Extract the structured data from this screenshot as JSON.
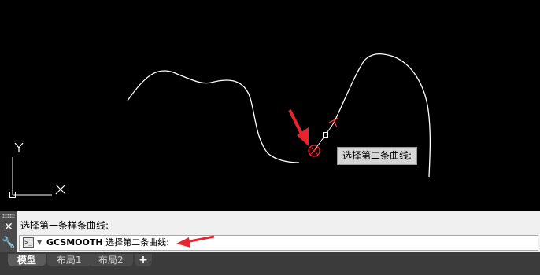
{
  "drawing": {
    "ucs_x_label": "X",
    "ucs_y_label": "Y",
    "tooltip": "选择第二条曲线:"
  },
  "command_line": {
    "history": "选择第一条样条曲线:",
    "command_name": "GCSMOOTH",
    "prompt": "选择第二条曲线:",
    "close_icon": "close-icon",
    "customize_icon": "wrench-icon",
    "prompt_icon": "command-prompt-icon"
  },
  "tabs": [
    {
      "label": "模型"
    },
    {
      "label": "布局1"
    },
    {
      "label": "布局2"
    }
  ],
  "colors": {
    "canvas": "#000000",
    "curve": "#ffffff",
    "marker": "#ff0000",
    "arrow": "#e8252c",
    "tooltip_bg": "#d6d6d6",
    "panel_bg": "#f0f0f0",
    "tab_bar": "#3b3b3b"
  }
}
